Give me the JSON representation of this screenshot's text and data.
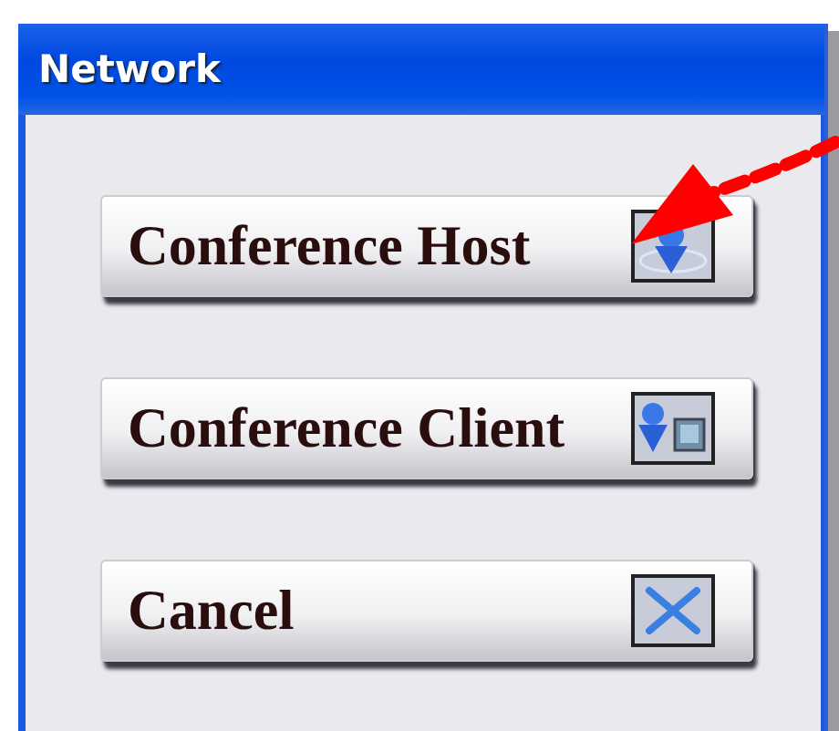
{
  "window": {
    "title": "Network"
  },
  "buttons": [
    {
      "label": "Conference Host",
      "kind": "host"
    },
    {
      "label": "Conference Client",
      "kind": "client"
    },
    {
      "label": "Cancel",
      "kind": "cancel"
    }
  ]
}
